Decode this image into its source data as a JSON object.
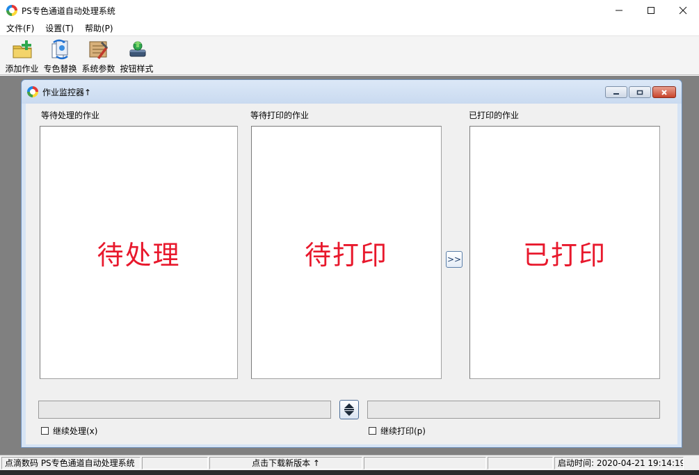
{
  "window": {
    "title": "PS专色通道自动处理系统",
    "controls": {
      "minimize": "—",
      "maximize": "☐",
      "close": "✕"
    }
  },
  "menu": [
    {
      "label": "文件(F)"
    },
    {
      "label": "设置(T)"
    },
    {
      "label": "帮助(P)"
    }
  ],
  "toolbar": [
    {
      "label": "添加作业",
      "icon": "add-job-icon"
    },
    {
      "label": "专色替换",
      "icon": "spot-color-replace-icon"
    },
    {
      "label": "系统参数",
      "icon": "system-params-icon"
    },
    {
      "label": "按钮样式",
      "icon": "button-style-icon"
    }
  ],
  "child_window": {
    "title": "作业监控器↑",
    "columns": {
      "pending": {
        "label": "等待处理的作业",
        "overlay": "待处理"
      },
      "waiting_print": {
        "label": "等待打印的作业",
        "overlay": "待打印"
      },
      "printed": {
        "label": "已打印的作业",
        "overlay": "已打印"
      }
    },
    "move_button": ">>",
    "continue_process": "继续处理(x)",
    "continue_print": "继续打印(p)"
  },
  "statusbar": {
    "app_name": "点滴数码 PS专色通道自动处理系统",
    "download": "点击下载新版本 ↑",
    "start_time": "启动时间: 2020-04-21 19:14:19"
  },
  "colors": {
    "overlay_text": "#e8182c",
    "mdi_background": "#808080",
    "child_frame": "#d6e4f5"
  }
}
